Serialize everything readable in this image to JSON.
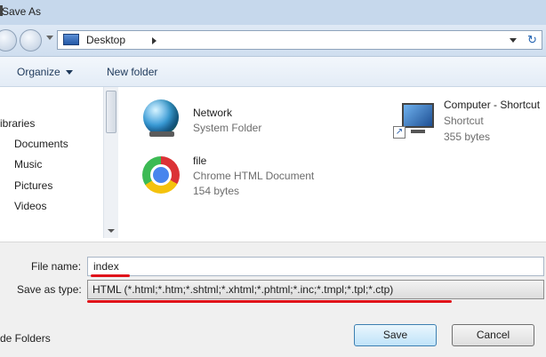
{
  "window": {
    "title": "Save As"
  },
  "address": {
    "location": "Desktop",
    "refresh_icon": "refresh-icon"
  },
  "toolbar": {
    "organize_label": "Organize",
    "new_folder_label": "New folder"
  },
  "nav_pane": {
    "items": [
      "ibraries",
      "Documents",
      "Music",
      "Pictures",
      "Videos"
    ]
  },
  "files": [
    {
      "name": "Network",
      "type": "System Folder",
      "icon": "network-icon"
    },
    {
      "name": "file",
      "type": "Chrome HTML Document",
      "size": "154 bytes",
      "icon": "chrome-icon"
    },
    {
      "name": "Computer - Shortcut",
      "type": "Shortcut",
      "size": "355 bytes",
      "icon": "computer-shortcut-icon"
    }
  ],
  "form": {
    "file_name_label": "File name:",
    "file_name_value": "index",
    "save_type_label": "Save as type:",
    "save_type_value": "HTML (*.html;*.htm;*.shtml;*.xhtml;*.phtml;*.inc;*.tmpl;*.tpl;*.ctp)"
  },
  "footer": {
    "hide_folders_label": "de Folders",
    "save_label": "Save",
    "cancel_label": "Cancel"
  },
  "colors": {
    "annotation_red": "#e0121a",
    "title_bar": "#c6d8ec"
  }
}
